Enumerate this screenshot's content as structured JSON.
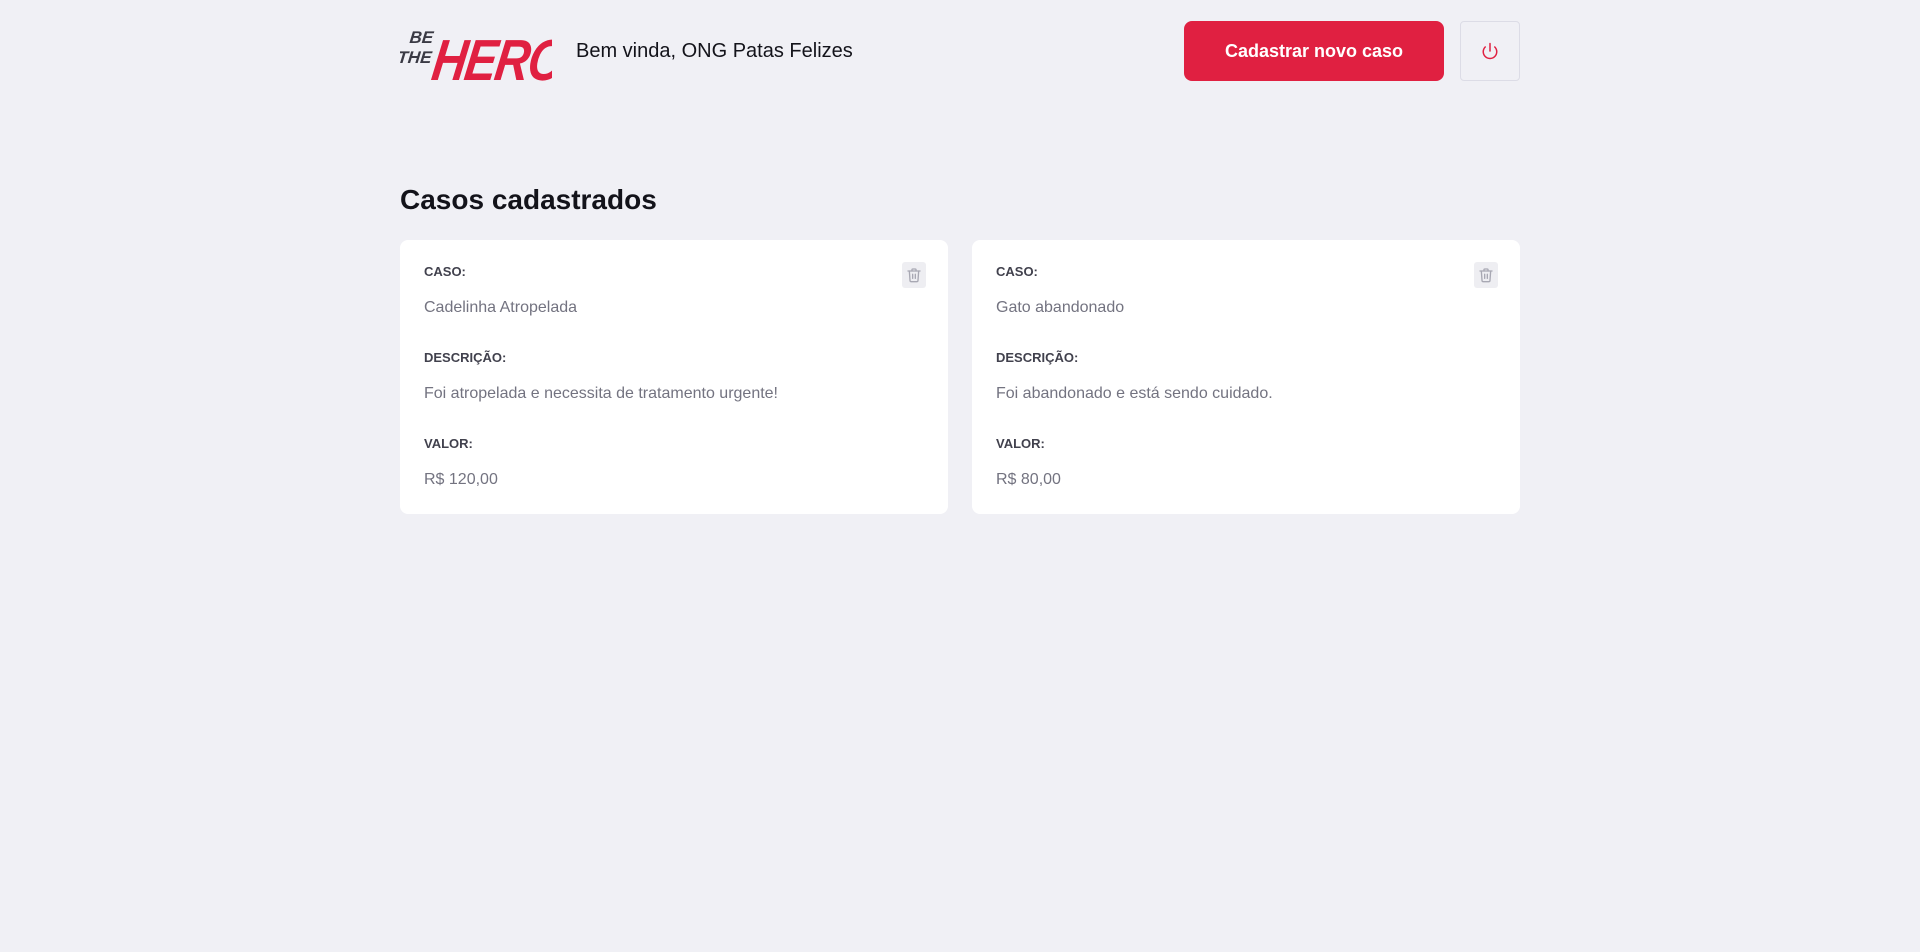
{
  "brand": {
    "logo_top": "BE",
    "logo_mid": "THE",
    "logo_main": "HERO",
    "accent_color": "#E02041"
  },
  "header": {
    "welcome_text": "Bem vinda, ONG Patas Felizes",
    "new_case_label": "Cadastrar novo caso",
    "logout_icon": "power-icon"
  },
  "main": {
    "title": "Casos cadastrados",
    "cases": [
      {
        "case_label": "CASO:",
        "case_value": "Cadelinha Atropelada",
        "description_label": "DESCRIÇÃO:",
        "description_value": "Foi atropelada e necessita de tratamento urgente!",
        "value_label": "VALOR:",
        "value_value": "R$ 120,00",
        "delete_icon": "trash-icon"
      },
      {
        "case_label": "CASO:",
        "case_value": "Gato abandonado",
        "description_label": "DESCRIÇÃO:",
        "description_value": "Foi abandonado e está sendo cuidado.",
        "value_label": "VALOR:",
        "value_value": "R$ 80,00",
        "delete_icon": "trash-icon"
      }
    ]
  }
}
